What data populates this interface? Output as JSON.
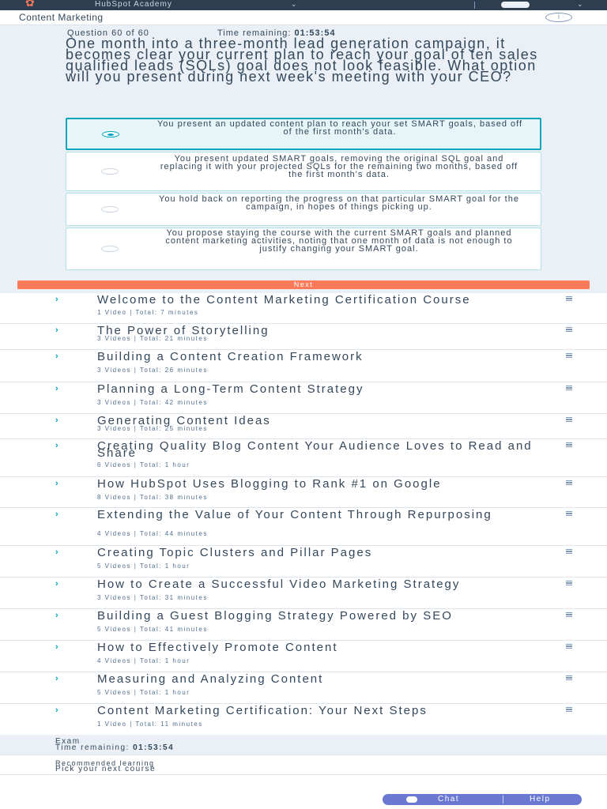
{
  "header": {
    "brand": "HubSpot Academy",
    "logo_icon": "sprocket-icon",
    "course_title": "Content Marketing"
  },
  "quiz": {
    "question_counter": "Question 60 of 60",
    "time_label": "Time remaining:",
    "time_value": "01:53:54",
    "question": "One month into a three-month lead generation campaign, it becomes clear your current plan to reach your goal of ten sales qualified leads (SQLs) goal does not look feasible. What option will you present during next week's meeting with your CEO?",
    "options": [
      {
        "text": "You present an updated content plan to reach your set SMART goals, based off of the first month's data.",
        "selected": true
      },
      {
        "text": "You present updated SMART goals, removing the original SQL goal and replacing it with your projected SQLs for the remaining two months, based off the first month's data.",
        "selected": false
      },
      {
        "text": "You hold back on reporting the progress on that particular SMART goal for the campaign, in hopes of things picking up.",
        "selected": false
      },
      {
        "text": "You propose staying the course with the current SMART goals and planned content marketing activities, noting that one month of data is not enough to justify changing your SMART goal.",
        "selected": false
      }
    ],
    "next_label": "Next"
  },
  "lessons": [
    {
      "title": "Welcome to the Content Marketing Certification Course",
      "meta": "1 Video | Total: 7 minutes"
    },
    {
      "title": "The Power of Storytelling",
      "meta": "3 Videos | Total: 21 minutes"
    },
    {
      "title": "Building a Content Creation Framework",
      "meta": "3 Videos | Total: 26 minutes"
    },
    {
      "title": "Planning a Long-Term Content Strategy",
      "meta": "3 Videos | Total: 42 minutes"
    },
    {
      "title": "Generating Content Ideas",
      "meta": "3 Videos | Total: 25 minutes"
    },
    {
      "title": "Creating Quality Blog Content Your Audience Loves to Read and Share",
      "meta": "6 Videos | Total: 1 hour"
    },
    {
      "title": "How HubSpot Uses Blogging to Rank #1 on Google",
      "meta": "8 Videos | Total: 38 minutes"
    },
    {
      "title": "Extending the Value of Your Content Through Repurposing",
      "meta": "4 Videos | Total: 44 minutes"
    },
    {
      "title": "Creating Topic Clusters and Pillar Pages",
      "meta": "5 Videos | Total: 1 hour"
    },
    {
      "title": "How to Create a Successful Video Marketing Strategy",
      "meta": "3 Videos | Total: 31 minutes"
    },
    {
      "title": "Building a Guest Blogging Strategy Powered by SEO",
      "meta": "5 Videos | Total: 41 minutes"
    },
    {
      "title": "How to Effectively Promote Content",
      "meta": "4 Videos | Total: 1 hour"
    },
    {
      "title": "Measuring and Analyzing Content",
      "meta": "5 Videos | Total: 1 hour"
    },
    {
      "title": "Content Marketing Certification: Your Next Steps",
      "meta": "1 Video | Total: 11 minutes"
    }
  ],
  "exam": {
    "label": "Exam",
    "time_label": "Time remaining:",
    "time_value": "01:53:54"
  },
  "recommended": {
    "label": "Recommended learning",
    "link": "Pick your next course"
  },
  "help_widget": {
    "chat_label": "Chat",
    "help_label": "Help"
  },
  "colors": {
    "accent": "#ff7a59",
    "teal": "#00a4bd",
    "nav_bg": "#2d3e50",
    "panel_bg": "#eaf0f6",
    "widget": "#6a78d1"
  }
}
